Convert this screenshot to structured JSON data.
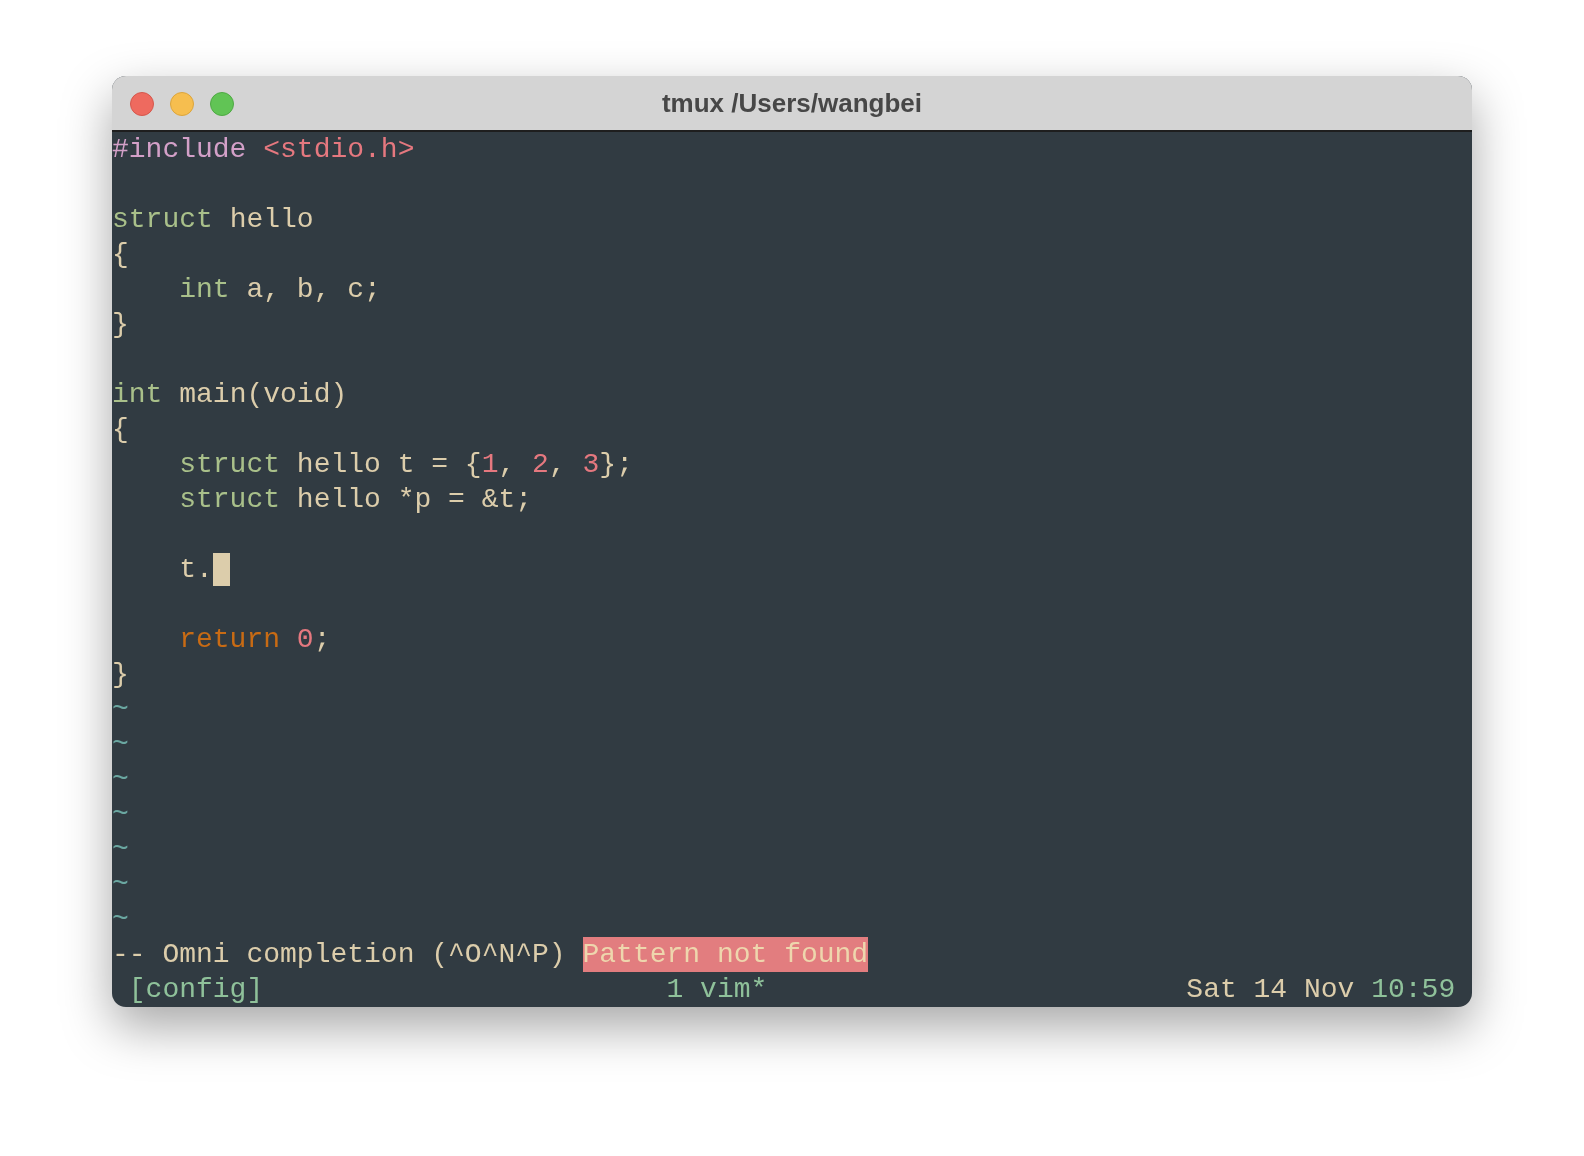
{
  "window": {
    "title": "tmux /Users/wangbei"
  },
  "editor": {
    "lines": [
      {
        "cursor": false,
        "indented": false,
        "tokens": [
          {
            "kind": "preproc",
            "text": "#include"
          },
          {
            "kind": "string",
            "text": " <stdio.h>"
          }
        ]
      },
      {
        "cursor": false
      },
      {
        "cursor": false,
        "indented": false,
        "tokens": [
          {
            "kind": "keyword",
            "text": "struct"
          },
          {
            "kind": "plain",
            "text": " hello"
          }
        ]
      },
      {
        "cursor": false,
        "indented": false,
        "tokens": [
          {
            "kind": "plain",
            "text": "{"
          }
        ]
      },
      {
        "cursor": false,
        "indented": true,
        "tokens": [
          {
            "kind": "keyword",
            "text": "int"
          },
          {
            "kind": "plain",
            "text": " a, b, c;"
          }
        ]
      },
      {
        "cursor": false,
        "indented": false,
        "tokens": [
          {
            "kind": "plain",
            "text": "}"
          }
        ]
      },
      {
        "cursor": false
      },
      {
        "cursor": false,
        "indented": false,
        "tokens": [
          {
            "kind": "keyword",
            "text": "int"
          },
          {
            "kind": "plain",
            "text": " main(void)"
          }
        ]
      },
      {
        "cursor": false,
        "indented": false,
        "tokens": [
          {
            "kind": "plain",
            "text": "{"
          }
        ]
      },
      {
        "cursor": false,
        "indented": true,
        "tokens": [
          {
            "kind": "keyword",
            "text": "struct"
          },
          {
            "kind": "plain",
            "text": " hello t = {"
          },
          {
            "kind": "number",
            "text": "1"
          },
          {
            "kind": "plain",
            "text": ", "
          },
          {
            "kind": "number",
            "text": "2"
          },
          {
            "kind": "plain",
            "text": ", "
          },
          {
            "kind": "number",
            "text": "3"
          },
          {
            "kind": "plain",
            "text": "};"
          }
        ]
      },
      {
        "cursor": false,
        "indented": true,
        "tokens": [
          {
            "kind": "keyword",
            "text": "struct"
          },
          {
            "kind": "plain",
            "text": " hello *p = &t;"
          }
        ]
      },
      {
        "cursor": false
      },
      {
        "cursor": true,
        "indented": true,
        "tokens": [
          {
            "kind": "plain",
            "text": "t."
          }
        ]
      },
      {
        "cursor": false
      },
      {
        "cursor": false,
        "indented": true,
        "tokens": [
          {
            "kind": "statement",
            "text": "return"
          },
          {
            "kind": "number",
            "text": " 0"
          },
          {
            "kind": "plain",
            "text": ";"
          }
        ]
      },
      {
        "cursor": false,
        "indented": false,
        "tokens": [
          {
            "kind": "plain",
            "text": "}"
          }
        ]
      }
    ],
    "filler": [
      "~",
      "~",
      "~",
      "~",
      "~",
      "~",
      "~"
    ],
    "message": {
      "mode": "-- Omni completion (^O^N^P)",
      "error": "Pattern not found"
    }
  },
  "status_bar": {
    "session": "[config]",
    "window": "1 vim*",
    "date": "Sat 14 Nov",
    "time": "10:59"
  }
}
